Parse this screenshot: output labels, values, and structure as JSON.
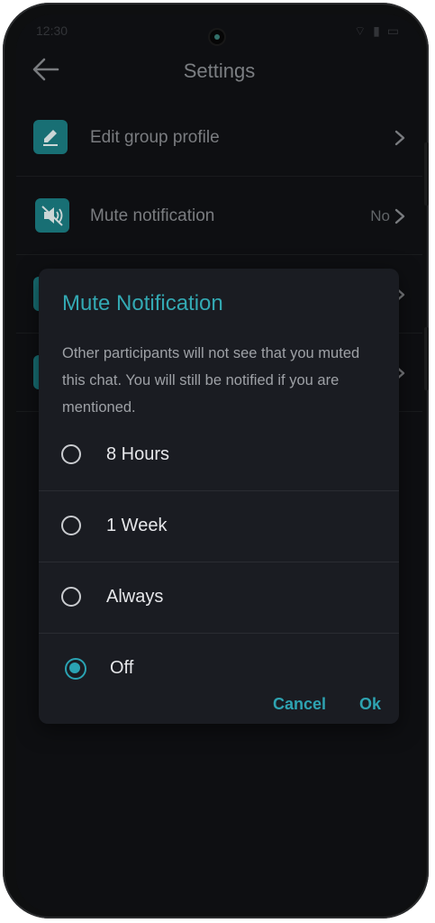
{
  "statusbar": {
    "time": "12:30",
    "icons": "⌔ ▮ ▭"
  },
  "appbar": {
    "title": "Settings"
  },
  "settings": {
    "items": [
      {
        "label": "Edit group profile",
        "value": ""
      },
      {
        "label": "Mute notification",
        "value": "No"
      }
    ]
  },
  "dialog": {
    "title": "Mute Notification",
    "message": "Other participants will not see that you muted this chat. You will still be notified if you are mentioned.",
    "options": [
      {
        "label": "8 Hours",
        "selected": false
      },
      {
        "label": "1 Week",
        "selected": false
      },
      {
        "label": "Always",
        "selected": false
      },
      {
        "label": "Off",
        "selected": true
      }
    ],
    "cancel_label": "Cancel",
    "ok_label": "Ok"
  },
  "colors": {
    "accent": "#2aa3b3",
    "icon_bg": "#1c7f85",
    "background": "#111215",
    "dialog": "#1a1c22"
  }
}
